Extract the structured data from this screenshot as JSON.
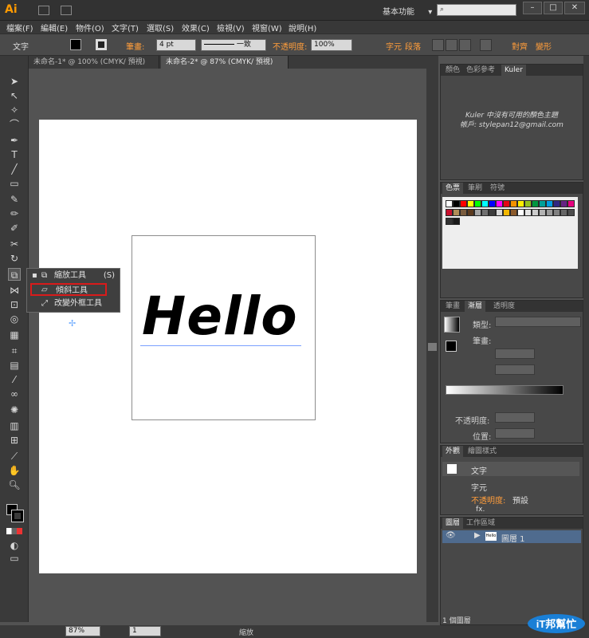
{
  "app": {
    "logo": "Ai",
    "workspace": "基本功能",
    "workspace_arrow": "▾"
  },
  "menu": [
    "檔案(F)",
    "編輯(E)",
    "物件(O)",
    "文字(T)",
    "選取(S)",
    "效果(C)",
    "檢視(V)",
    "視窗(W)",
    "說明(H)"
  ],
  "control": {
    "context": "文字",
    "stroke_label": "筆畫:",
    "stroke_value": "4 pt",
    "stroke_style": "一致",
    "opacity_label": "不透明度:",
    "opacity_value": "100%",
    "char_label": "字元",
    "para_label": "段落",
    "align_label": "對齊",
    "transform_label": "變形"
  },
  "doc_tabs": [
    "未命名-1* @ 100% (CMYK/ 預視)",
    "未命名-2* @ 87% (CMYK/ 預視)"
  ],
  "canvas": {
    "text": "Hello"
  },
  "flyout": {
    "items": [
      {
        "label": "縮放工具",
        "shortcut": "(S)"
      },
      {
        "label": "傾斜工具",
        "shortcut": ""
      },
      {
        "label": "改變外框工具",
        "shortcut": ""
      }
    ]
  },
  "panels": {
    "color_group": {
      "tabs": [
        "顏色",
        "色彩參考",
        "Kuler"
      ],
      "kuler_msg": "Kuler 中沒有可用的顏色主題",
      "account": "帳戶: stylepan12@gmail.com"
    },
    "swatch_group": {
      "tabs": [
        "色票",
        "筆刷",
        "符號"
      ]
    },
    "stroke_group": {
      "tabs": [
        "筆畫",
        "漸層",
        "透明度"
      ],
      "type_label": "類型:",
      "stroke_label": "筆畫:",
      "opacity_label": "不透明度:",
      "position_label": "位置:"
    },
    "appearance": {
      "tabs": [
        "外觀",
        "繪圖樣式"
      ],
      "rows": [
        "文字",
        "字元",
        "不透明度:"
      ],
      "opacity_value": "預設",
      "fx": "fx."
    },
    "layers": {
      "tabs": [
        "圖層",
        "工作區域"
      ],
      "layer_name": "圖層 1",
      "thumb": "Hello",
      "count": "1 個圖層"
    }
  },
  "status": {
    "zoom": "87%",
    "page": "1",
    "mode": "縮放"
  },
  "watermark": {
    "text": "iT邦幫忙"
  }
}
